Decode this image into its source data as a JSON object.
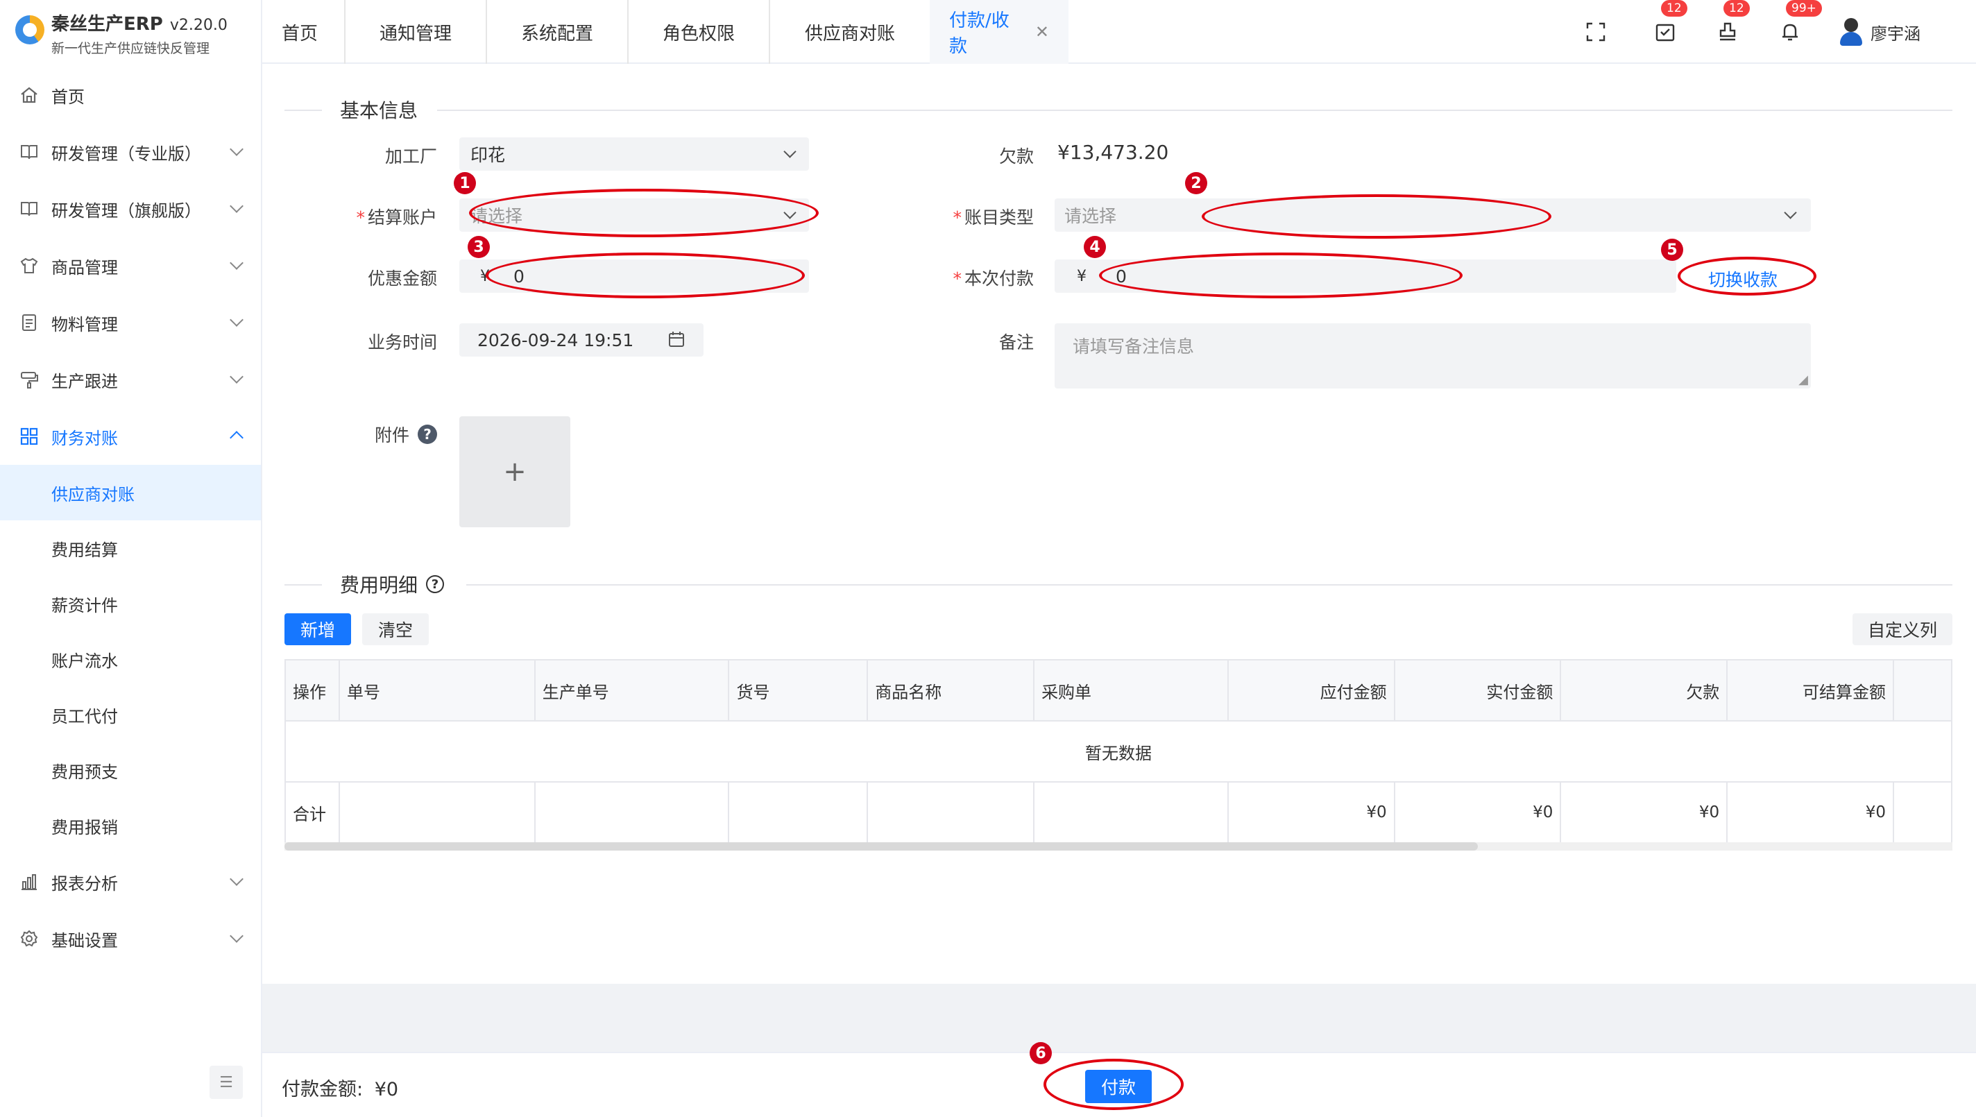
{
  "brand": {
    "title": "秦丝生产ERP",
    "version": "v2.20.0",
    "subtitle": "新一代生产供应链快反管理"
  },
  "sidebar": {
    "items": [
      {
        "label": "首页",
        "icon": "home-icon"
      },
      {
        "label": "研发管理（专业版）",
        "icon": "book-icon"
      },
      {
        "label": "研发管理（旗舰版）",
        "icon": "book-icon"
      },
      {
        "label": "商品管理",
        "icon": "shirt-icon"
      },
      {
        "label": "物料管理",
        "icon": "document-icon"
      },
      {
        "label": "生产跟进",
        "icon": "roller-icon"
      },
      {
        "label": "财务对账",
        "icon": "grid-icon"
      }
    ],
    "finance_sub": [
      "供应商对账",
      "费用结算",
      "薪资计件",
      "账户流水",
      "员工代付",
      "费用预支",
      "费用报销"
    ],
    "bottom_items": [
      {
        "label": "报表分析",
        "icon": "bar-chart-icon"
      },
      {
        "label": "基础设置",
        "icon": "gear-icon"
      }
    ]
  },
  "tabs": [
    "首页",
    "通知管理",
    "系统配置",
    "角色权限",
    "供应商对账",
    "付款/收款"
  ],
  "header": {
    "badge_tasks": "12",
    "badge_stamp": "12",
    "badge_bell": "99+",
    "user_name": "廖宇涵"
  },
  "form": {
    "section_basic": "基本信息",
    "factory_label": "加工厂",
    "factory_value": "印花",
    "debt_label": "欠款",
    "debt_value": "¥13,473.20",
    "account_label": "结算账户",
    "account_placeholder": "请选择",
    "account_type_label": "账目类型",
    "account_type_placeholder": "请选择",
    "discount_label": "优惠金额",
    "discount_currency": "¥",
    "discount_value": "0",
    "payment_label": "本次付款",
    "payment_currency": "¥",
    "payment_value": "0",
    "switch_label": "切换收款",
    "time_label": "业务时间",
    "time_value": "2026-09-24 19:51",
    "remark_label": "备注",
    "remark_placeholder": "请填写备注信息",
    "attach_label": "附件",
    "upload_plus": "+"
  },
  "expense": {
    "section_title": "费用明细",
    "add_label": "新增",
    "clear_label": "清空",
    "custom_col_label": "自定义列",
    "columns": [
      "操作",
      "单号",
      "生产单号",
      "货号",
      "商品名称",
      "采购单",
      "应付金额",
      "实付金额",
      "欠款",
      "可结算金额"
    ],
    "empty_text": "暂无数据",
    "sum_label": "合计",
    "sum_values": [
      "¥0",
      "¥0",
      "¥0",
      "¥0"
    ]
  },
  "footer": {
    "total_label": "付款金额:",
    "total_value": "¥0",
    "pay_label": "付款"
  },
  "annotations": [
    "1",
    "2",
    "3",
    "4",
    "5",
    "6"
  ],
  "colors": {
    "primary": "#1677ff",
    "annotation": "#e00010",
    "badge": "#f53f3f"
  }
}
